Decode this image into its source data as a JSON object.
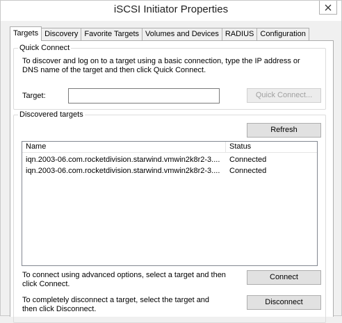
{
  "window": {
    "title": "iSCSI Initiator Properties"
  },
  "tabs": [
    {
      "label": "Targets",
      "active": true
    },
    {
      "label": "Discovery"
    },
    {
      "label": "Favorite Targets"
    },
    {
      "label": "Volumes and Devices"
    },
    {
      "label": "RADIUS"
    },
    {
      "label": "Configuration"
    }
  ],
  "quick_connect": {
    "group_label": "Quick Connect",
    "description_line1": "To discover and log on to a target using a basic connection, type the IP address or",
    "description_line2": "DNS name of the target and then click Quick Connect.",
    "target_label": "Target:",
    "target_value": "",
    "button_label": "Quick Connect..."
  },
  "discovered": {
    "group_label": "Discovered targets",
    "refresh_label": "Refresh",
    "columns": [
      "Name",
      "Status"
    ],
    "rows": [
      {
        "name": "iqn.2003-06.com.rocketdivision.starwind.vmwin2k8r2-3....",
        "status": "Connected"
      },
      {
        "name": "iqn.2003-06.com.rocketdivision.starwind.vmwin2k8r2-3....",
        "status": "Connected"
      }
    ],
    "connect_text_line1": "To connect using advanced options, select a target and then",
    "connect_text_line2": "click Connect.",
    "connect_label": "Connect",
    "disconnect_text_line1": "To completely disconnect a target, select the target and",
    "disconnect_text_line2": "then click Disconnect.",
    "disconnect_label": "Disconnect"
  },
  "icons": {
    "close": "close-icon"
  }
}
